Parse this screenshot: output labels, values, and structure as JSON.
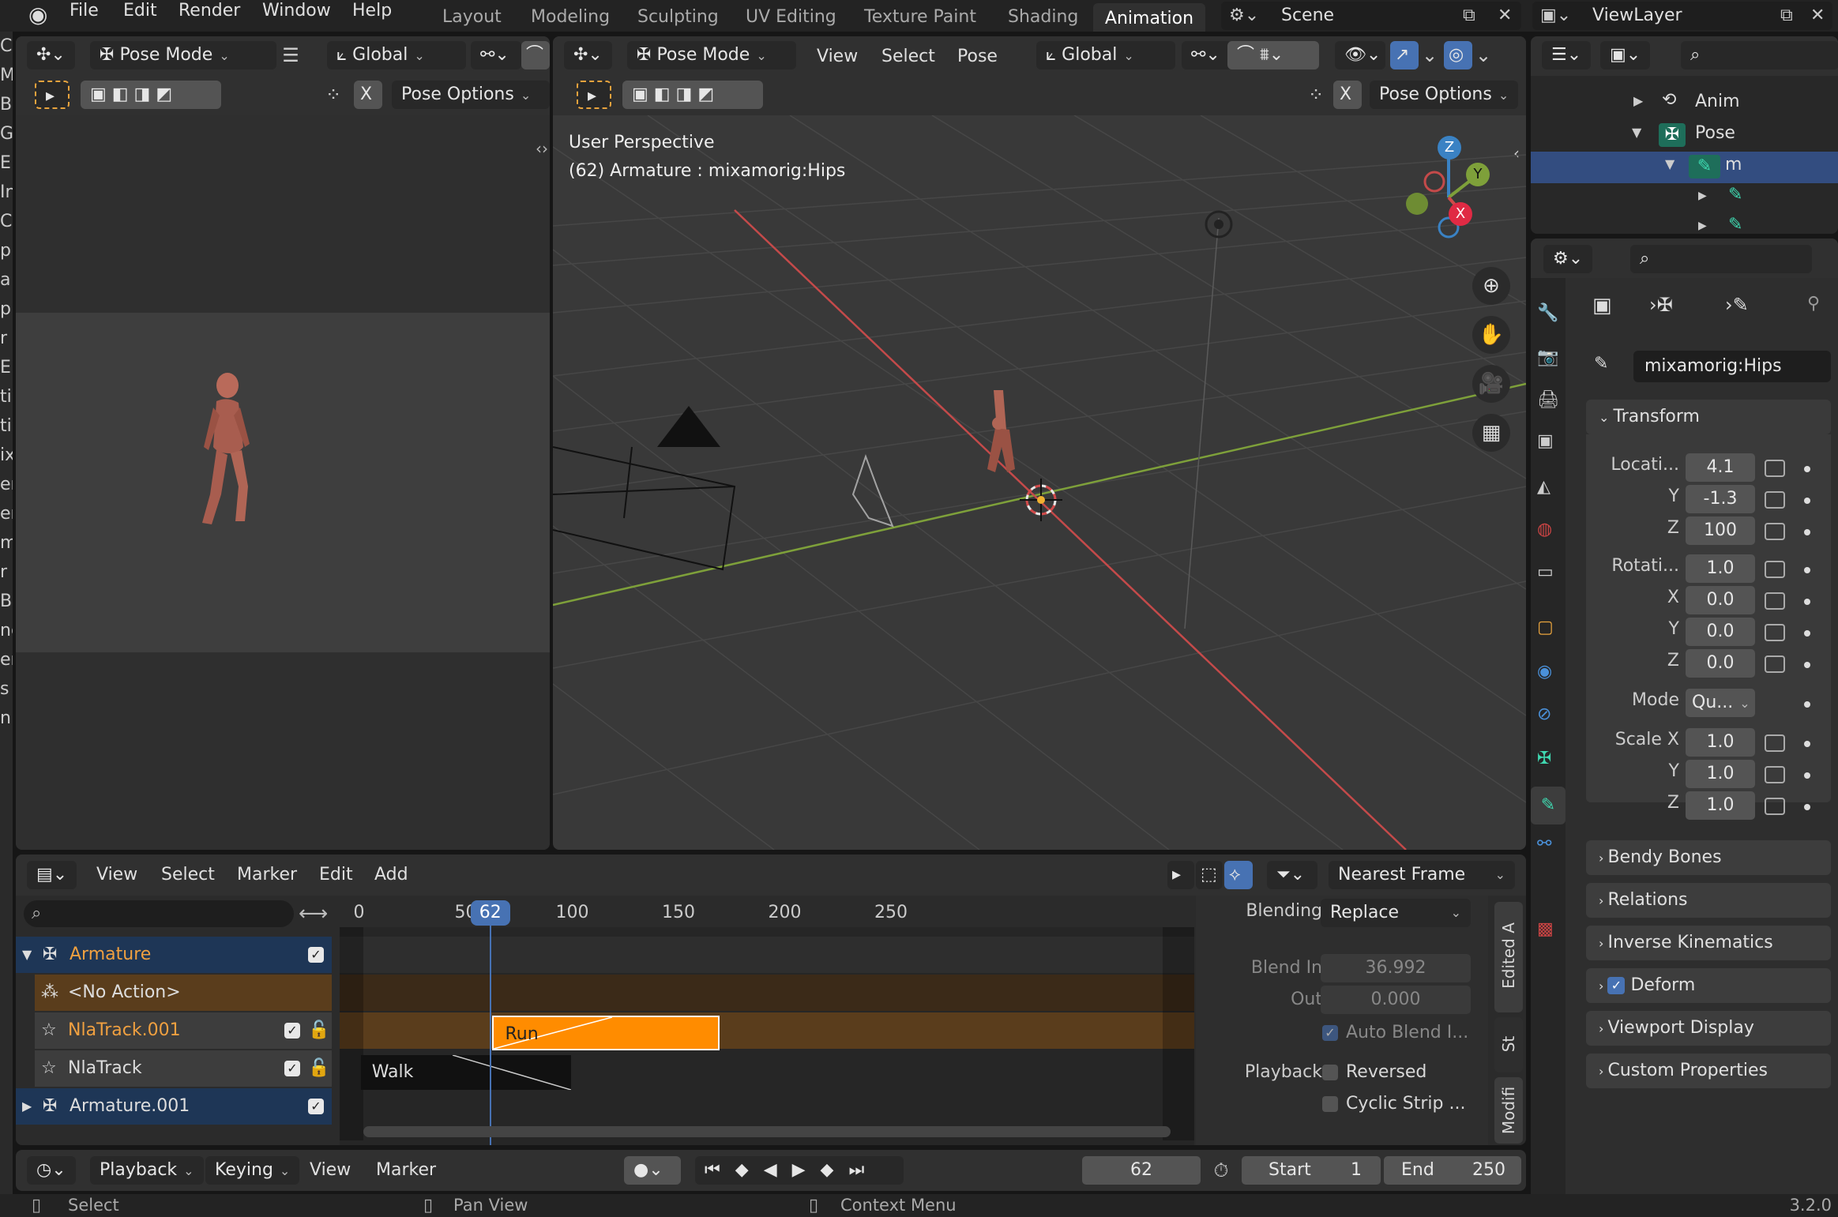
{
  "topbar": {
    "menus": [
      "File",
      "Edit",
      "Render",
      "Window",
      "Help"
    ],
    "workspaces": [
      "Layout",
      "Modeling",
      "Sculpting",
      "UV Editing",
      "Texture Paint",
      "Shading",
      "Animation"
    ],
    "active_workspace": "Animation",
    "scene": "Scene",
    "view_layer": "ViewLayer"
  },
  "left_edge_letters": [
    "Co",
    "Mi",
    "B",
    "G",
    "E",
    "In",
    "C",
    "p",
    "a",
    "p",
    "r",
    "E",
    "ti",
    "ti",
    "ix",
    "er",
    "er",
    "mi",
    "r",
    "B",
    "nc",
    "er",
    "s",
    "nl"
  ],
  "camera_view": {
    "mode": "Pose Mode",
    "orientation": "Global",
    "pose_options": "Pose Options",
    "x_label": "X"
  },
  "viewport": {
    "mode": "Pose Mode",
    "menus": [
      "View",
      "Select",
      "Pose"
    ],
    "orientation": "Global",
    "pose_options": "Pose Options",
    "x_label": "X",
    "overlay_title": "User Perspective",
    "overlay_subtitle": "(62) Armature : mixamorig:Hips",
    "gizmo": {
      "z": "Z",
      "y": "Y",
      "x": "X"
    }
  },
  "outliner": {
    "items": [
      {
        "label": "Anim"
      },
      {
        "label": "Pose"
      },
      {
        "label": "m"
      }
    ]
  },
  "properties": {
    "bone_name": "mixamorig:Hips",
    "transform_title": "Transform",
    "location_label": "Locati...",
    "location": [
      "4.1",
      "-1.3",
      "100"
    ],
    "rotation_label": "Rotati...",
    "rotation": [
      "1.0",
      "0.0",
      "0.0",
      "0.0"
    ],
    "axis_labels": [
      "X",
      "Y",
      "Z"
    ],
    "mode_label": "Mode",
    "mode_value": "Qu...",
    "scale_label": "Scale X",
    "scale": [
      "1.0",
      "1.0",
      "1.0"
    ],
    "sections": [
      "Bendy Bones",
      "Relations",
      "Inverse Kinematics",
      "Deform",
      "Viewport Display",
      "Custom Properties"
    ]
  },
  "nla": {
    "menus": [
      "View",
      "Select",
      "Marker",
      "Edit",
      "Add"
    ],
    "snap": "Nearest Frame",
    "ruler": [
      "0",
      "50",
      "100",
      "150",
      "200",
      "250"
    ],
    "current_frame": "62",
    "tracks": [
      {
        "label": "Armature"
      },
      {
        "label": "<No Action>"
      },
      {
        "label": "NlaTrack.001"
      },
      {
        "label": "NlaTrack"
      },
      {
        "label": "Armature.001"
      }
    ],
    "strips": [
      {
        "label": "Run",
        "start": 63,
        "end": 170
      },
      {
        "label": "Walk",
        "start": 1,
        "end": 100
      }
    ],
    "strip_panel": {
      "blending_label": "Blending",
      "blending_value": "Replace",
      "blend_in_label": "Blend In",
      "blend_in": "36.992",
      "out_label": "Out",
      "out": "0.000",
      "auto_blend": "Auto Blend I...",
      "playback_label": "Playback",
      "reversed": "Reversed",
      "cyclic": "Cyclic Strip ...",
      "tabs": [
        "Edited A",
        "St",
        "Modifi"
      ]
    }
  },
  "timeline": {
    "menus": [
      "Playback",
      "Keying",
      "View",
      "Marker"
    ],
    "frame": "62",
    "start_label": "Start",
    "start": "1",
    "end_label": "End",
    "end": "250"
  },
  "statusbar": {
    "items": [
      "Select",
      "Pan View",
      "Context Menu"
    ],
    "version": "3.2.0"
  },
  "colors": {
    "accent": "#4772b3",
    "strip_orange": "#ff8c00",
    "frame_blue": "#4772b3",
    "x_axis": "#c44a4a",
    "y_axis": "#7ea03a"
  }
}
